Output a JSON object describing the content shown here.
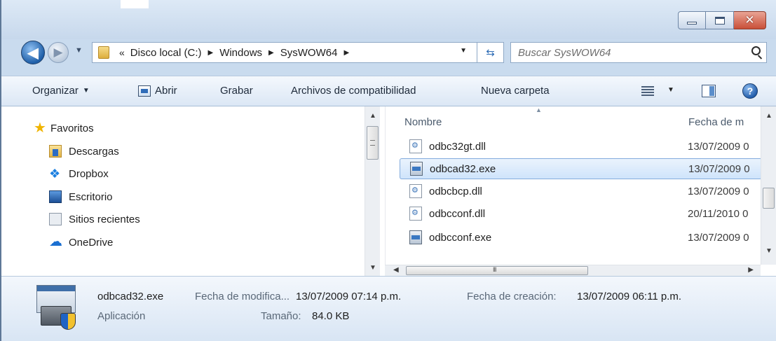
{
  "window": {
    "minimize_label": "Minimize",
    "maximize_label": "Maximize",
    "close_label": "Close"
  },
  "address": {
    "lead": "«",
    "crumbs": [
      "Disco local (C:)",
      "Windows",
      "SysWOW64"
    ]
  },
  "search": {
    "placeholder": "Buscar SysWOW64"
  },
  "toolbar": {
    "organize": "Organizar",
    "open": "Abrir",
    "burn": "Grabar",
    "compat": "Archivos de compatibilidad",
    "new_folder": "Nueva carpeta"
  },
  "nav": {
    "favorites": "Favoritos",
    "items": [
      "Descargas",
      "Dropbox",
      "Escritorio",
      "Sitios recientes",
      "OneDrive"
    ]
  },
  "columns": {
    "name": "Nombre",
    "date": "Fecha de m"
  },
  "files": [
    {
      "name": "odbc32gt.dll",
      "date": "13/07/2009 0",
      "type": "dll",
      "selected": false
    },
    {
      "name": "odbcad32.exe",
      "date": "13/07/2009 0",
      "type": "exe",
      "selected": true
    },
    {
      "name": "odbcbcp.dll",
      "date": "13/07/2009 0",
      "type": "dll",
      "selected": false
    },
    {
      "name": "odbcconf.dll",
      "date": "20/11/2010 0",
      "type": "dll",
      "selected": false
    },
    {
      "name": "odbcconf.exe",
      "date": "13/07/2009 0",
      "type": "exe",
      "selected": false
    }
  ],
  "details": {
    "name": "odbcad32.exe",
    "type": "Aplicación",
    "modified_label": "Fecha de modifica...",
    "modified_value": "13/07/2009 07:14 p.m.",
    "created_label": "Fecha de creación:",
    "created_value": "13/07/2009 06:11 p.m.",
    "size_label": "Tamaño:",
    "size_value": "84.0 KB"
  },
  "colors": {
    "frame": "#c9dbee",
    "selection": "#cfe4fb",
    "selection_border": "#84acdd",
    "close_button": "#c94f38"
  }
}
